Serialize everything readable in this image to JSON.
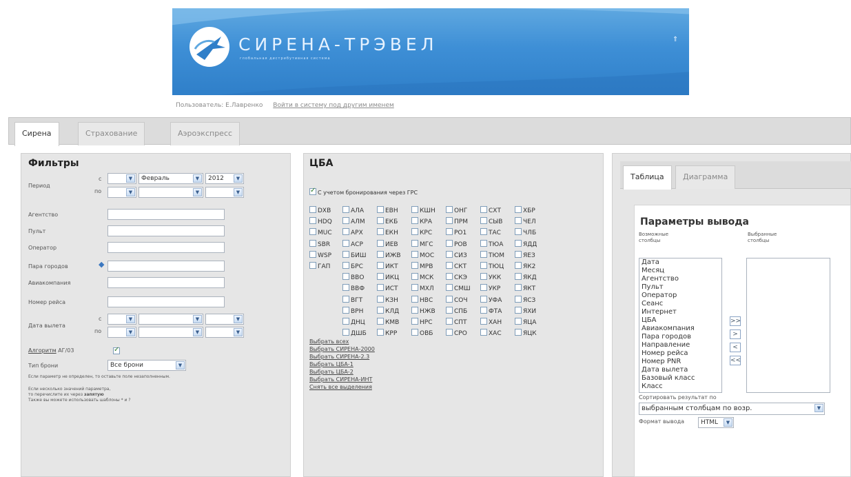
{
  "brand": {
    "logo_text": "СИРЕНА-ТРЭВЕЛ",
    "logo_sub": "глобальная дистрибутивная система"
  },
  "user": {
    "label": "Пользователь: Е.Лавренко",
    "relogin": "Войти в систему под другим именем"
  },
  "top_tabs": [
    "Сирена",
    "Страхование",
    "Аэроэкспресс"
  ],
  "filters": {
    "title": "Фильтры",
    "period": "Период",
    "from": "с",
    "to": "по",
    "month": "Февраль",
    "year": "2012",
    "agency": "Агентство",
    "desk": "Пульт",
    "operator": "Оператор",
    "city_pair": "Пара городов",
    "airline": "Авиакомпания",
    "flight": "Номер рейса",
    "dep_date": "Дата вылета",
    "algorithm": "Алгоритм",
    "algorithm_suffix": "АГ/03",
    "booking_type": "Тип брони",
    "booking_value": "Все брони",
    "hint1": "Если параметр не определен, то оставьте поле незаполненным.",
    "hint2": "Если несколько значений параметра,",
    "hint3_pre": "то перечислите их через ",
    "hint3_bold": "запятую",
    "hint4": "Также вы можете использовать шаблоны * и ?"
  },
  "tsba": {
    "title": "ЦБА",
    "grs_label": "С учетом бронирования через ГРС",
    "columns": [
      [
        "DXB",
        "HDQ",
        "MUC",
        "SBR",
        "WSP",
        "ГАП"
      ],
      [
        "АЛА",
        "АЛМ",
        "АРХ",
        "АСР",
        "БИШ",
        "БРС",
        "ВВО",
        "ВВФ",
        "ВГТ",
        "ВРН",
        "ДНЦ",
        "ДШБ"
      ],
      [
        "ЕВН",
        "ЕКБ",
        "ЕКН",
        "ИЕВ",
        "ИЖВ",
        "ИКТ",
        "ИКЦ",
        "ИСТ",
        "КЗН",
        "КЛД",
        "КМВ",
        "КРР"
      ],
      [
        "КШН",
        "КРА",
        "КРС",
        "МГС",
        "МОС",
        "МРВ",
        "МСК",
        "МХЛ",
        "НВС",
        "НЖВ",
        "НРС",
        "ОВБ"
      ],
      [
        "ОНГ",
        "ПРМ",
        "РО1",
        "РОВ",
        "СИЗ",
        "СКТ",
        "СКЭ",
        "СМШ",
        "СОЧ",
        "СПБ",
        "СПТ",
        "СРО"
      ],
      [
        "СХТ",
        "СЫВ",
        "ТАС",
        "ТЮА",
        "ТЮМ",
        "ТЮЦ",
        "УКК",
        "УКР",
        "УФА",
        "ФТА",
        "ХАН",
        "ХАС"
      ],
      [
        "ХБР",
        "ЧЕЛ",
        "ЧЛБ",
        "ЯДД",
        "ЯЕЗ",
        "ЯК2",
        "ЯКД",
        "ЯКТ",
        "ЯСЗ",
        "ЯХИ",
        "ЯЦА",
        "ЯЦК"
      ]
    ],
    "links": [
      "Выбрать всех",
      "Выбрать СИРЕНА-2000",
      "Выбрать СИРЕНА-2.3",
      "Выбрать ЦБА-1",
      "Выбрать ЦБА-2",
      "Выбрать СИРЕНА-ИНТ",
      "Снять все выделения"
    ]
  },
  "right": {
    "tabs": [
      "Таблица",
      "Диаграмма"
    ],
    "params_title": "Параметры вывода",
    "possible_cols": "Возможные столбцы",
    "selected_cols": "Выбранные столбцы",
    "columns_list": [
      "Дата",
      "Месяц",
      "Агентство",
      "Пульт",
      "Оператор",
      "Сеанс",
      "Интернет",
      "ЦБА",
      "Авиакомпания",
      "Пара городов",
      "Направление",
      "Номер рейса",
      "Номер PNR",
      "Дата вылета",
      "Базовый класс",
      "Класс"
    ],
    "buttons": [
      ">>",
      ">",
      "<",
      "<<"
    ],
    "sort_label": "Сортировать результат по",
    "sort_value": "выбранным столбцам по возр.",
    "format_label": "Формат вывода",
    "format_value": "HTML"
  }
}
